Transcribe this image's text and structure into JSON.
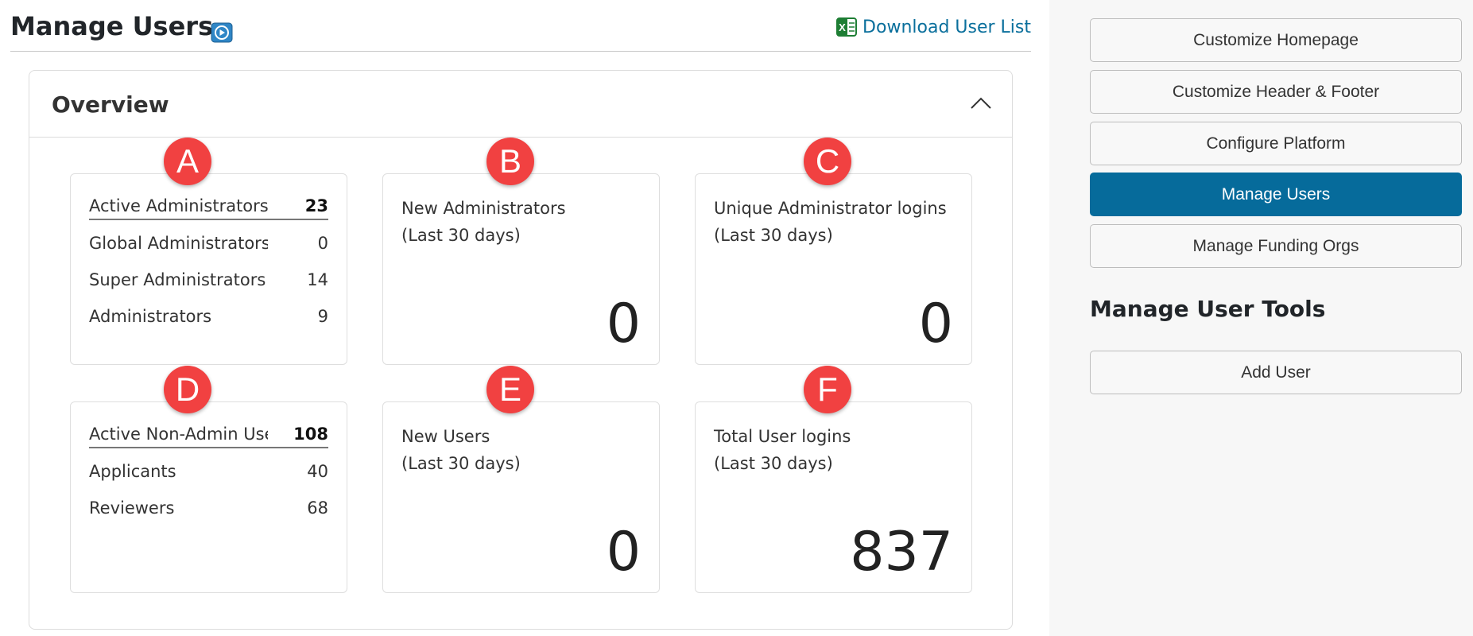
{
  "header": {
    "title": "Manage Users",
    "download_label": "Download User List",
    "icons": {
      "video": "play-video-icon",
      "excel": "excel-icon"
    }
  },
  "overview": {
    "title": "Overview",
    "collapse_icon": "chevron-up-icon",
    "cards": [
      {
        "marker": "A",
        "rows": [
          {
            "label": "Active Administrators",
            "value": "23"
          },
          {
            "label": "Global Administrators",
            "value": "0"
          },
          {
            "label": "Super Administrators",
            "value": "14"
          },
          {
            "label": "Administrators",
            "value": "9"
          }
        ]
      },
      {
        "marker": "B",
        "label_line1": "New Administrators",
        "label_line2": "(Last 30 days)",
        "value": "0"
      },
      {
        "marker": "C",
        "label_line1": "Unique Administrator logins",
        "label_line2": "(Last 30 days)",
        "value": "0"
      },
      {
        "marker": "D",
        "rows": [
          {
            "label": "Active Non-Admin Users",
            "value": "108"
          },
          {
            "label": "Applicants",
            "value": "40"
          },
          {
            "label": "Reviewers",
            "value": "68"
          }
        ]
      },
      {
        "marker": "E",
        "label_line1": "New Users",
        "label_line2": "(Last 30 days)",
        "value": "0"
      },
      {
        "marker": "F",
        "label_line1": "Total User logins",
        "label_line2": "(Last 30 days)",
        "value": "837"
      }
    ]
  },
  "sidebar": {
    "buttons": [
      {
        "label": "Customize Homepage",
        "active": false
      },
      {
        "label": "Customize Header & Footer",
        "active": false
      },
      {
        "label": "Configure Platform",
        "active": false
      },
      {
        "label": "Manage Users",
        "active": true
      },
      {
        "label": "Manage Funding Orgs",
        "active": false
      }
    ],
    "tools_title": "Manage User Tools",
    "tools_buttons": [
      {
        "label": "Add User"
      }
    ]
  },
  "colors": {
    "accent": "#066b9b",
    "link": "#0a6f9c",
    "marker": "#f14141",
    "excel_green": "#1e7e34"
  }
}
